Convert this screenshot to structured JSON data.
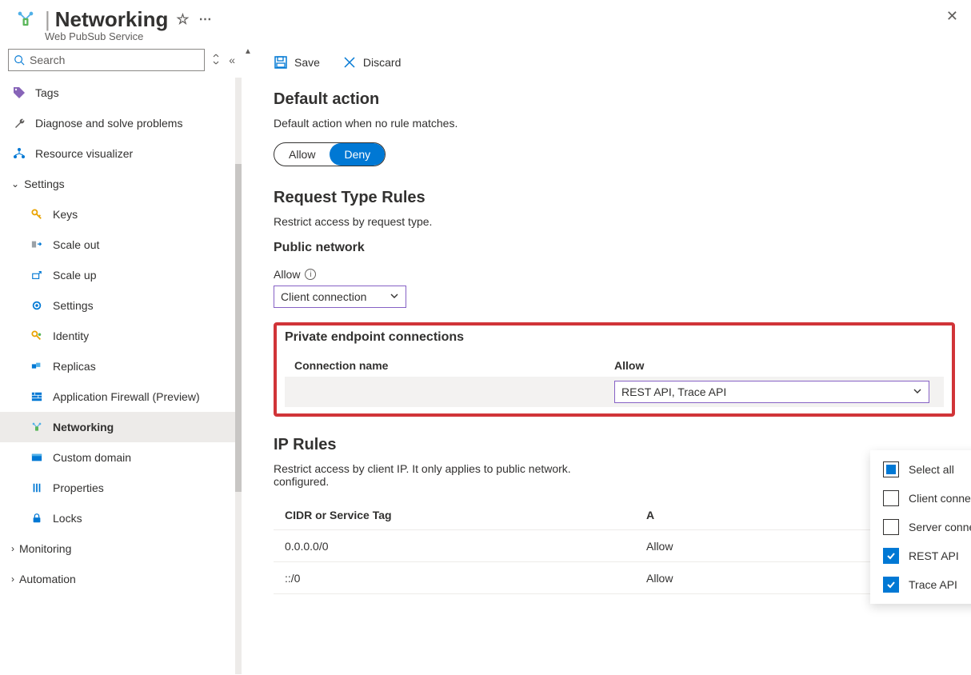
{
  "header": {
    "title": "Networking",
    "subtitle": "Web PubSub Service"
  },
  "sidebar": {
    "search_placeholder": "Search",
    "items": {
      "tags": "Tags",
      "diagnose": "Diagnose and solve problems",
      "resviz": "Resource visualizer",
      "settings": "Settings",
      "keys": "Keys",
      "scaleout": "Scale out",
      "scaleup": "Scale up",
      "settings2": "Settings",
      "identity": "Identity",
      "replicas": "Replicas",
      "appfw": "Application Firewall (Preview)",
      "networking": "Networking",
      "customdomain": "Custom domain",
      "properties": "Properties",
      "locks": "Locks",
      "monitoring": "Monitoring",
      "automation": "Automation"
    }
  },
  "cmdbar": {
    "save": "Save",
    "discard": "Discard"
  },
  "sections": {
    "default_action": {
      "title": "Default action",
      "desc": "Default action when no rule matches.",
      "allow": "Allow",
      "deny": "Deny"
    },
    "request_rules": {
      "title": "Request Type Rules",
      "desc": "Restrict access by request type.",
      "public_network": "Public network",
      "allow_label": "Allow",
      "allow_value": "Client connection"
    },
    "private_ep": {
      "title": "Private endpoint connections",
      "col_name": "Connection name",
      "col_allow": "Allow",
      "row_allow_value": "REST API, Trace API"
    },
    "dropdown_options": {
      "select_all": "Select all",
      "client": "Client connection",
      "server": "Server connection",
      "rest": "REST API",
      "trace": "Trace API"
    },
    "ip_rules": {
      "title": "IP Rules",
      "desc": "Restrict access by client IP. It only applies to public network.",
      "desc_suffix": "configured.",
      "col_cidr": "CIDR or Service Tag",
      "col_action_initial": "A",
      "rows": [
        {
          "cidr": "0.0.0.0/0",
          "action": "Allow"
        },
        {
          "cidr": "::/0",
          "action": "Allow"
        }
      ]
    }
  }
}
